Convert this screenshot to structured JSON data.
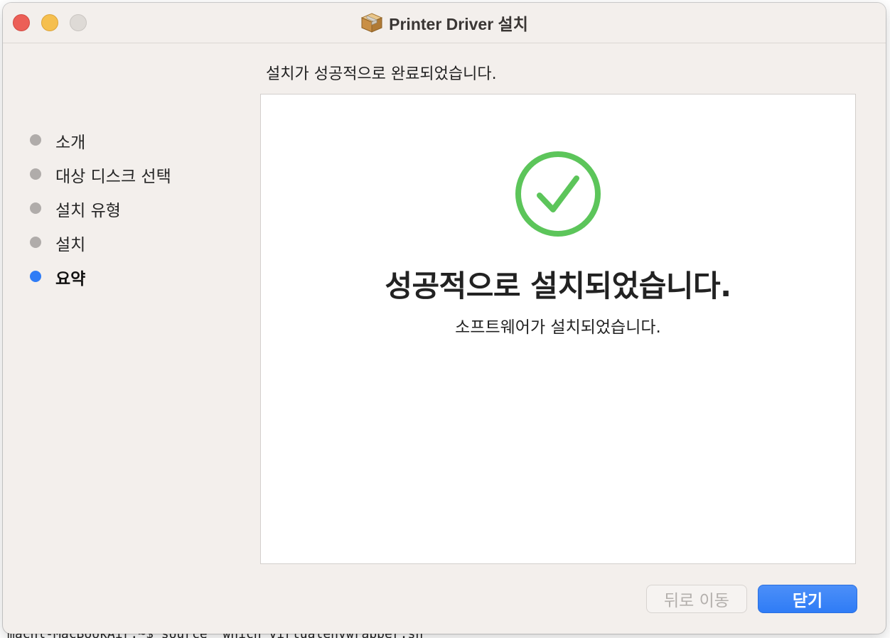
{
  "window": {
    "title": "Printer Driver 설치",
    "title_icon": "package-box-icon"
  },
  "heading": "설치가 성공적으로 완료되었습니다.",
  "steps": [
    {
      "label": "소개",
      "state": "done"
    },
    {
      "label": "대상 디스크 선택",
      "state": "done"
    },
    {
      "label": "설치 유형",
      "state": "done"
    },
    {
      "label": "설치",
      "state": "done"
    },
    {
      "label": "요약",
      "state": "active"
    }
  ],
  "content": {
    "icon": "checkmark-circle-icon",
    "title": "성공적으로 설치되었습니다.",
    "subtitle": "소프트웨어가 설치되었습니다."
  },
  "buttons": {
    "back": "뒤로 이동",
    "close": "닫기"
  },
  "background": {
    "terminal_text": "macnl-MacBookAir:~$ source `which virtualenvwrapper.sh`"
  },
  "colors": {
    "accent": "#2f7cf6",
    "success": "#5cc55a",
    "window_bg": "#f3efec"
  }
}
